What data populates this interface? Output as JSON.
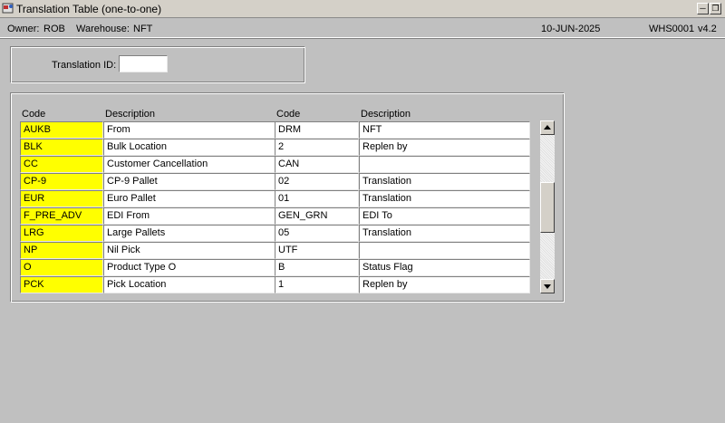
{
  "window": {
    "title": "Translation Table (one-to-one)"
  },
  "infobar": {
    "owner_label": "Owner:",
    "owner_value": "ROB",
    "warehouse_label": "Warehouse:",
    "warehouse_value": "NFT",
    "date": "10-JUN-2025",
    "module": "WHS0001",
    "version": "v4.2"
  },
  "search": {
    "label": "Translation ID:",
    "value": ""
  },
  "table": {
    "headers": [
      "Code",
      "Description",
      "Code",
      "Description"
    ],
    "rows": [
      {
        "code": "AUKB",
        "description": "From",
        "code2": "DRM",
        "description2": "NFT"
      },
      {
        "code": "BLK",
        "description": "Bulk Location",
        "code2": "2",
        "description2": "Replen by"
      },
      {
        "code": "CC",
        "description": "Customer Cancellation",
        "code2": "CAN",
        "description2": ""
      },
      {
        "code": "CP-9",
        "description": "CP-9 Pallet",
        "code2": "02",
        "description2": "Translation"
      },
      {
        "code": "EUR",
        "description": "Euro Pallet",
        "code2": "01",
        "description2": "Translation"
      },
      {
        "code": "F_PRE_ADV",
        "description": "EDI From",
        "code2": "GEN_GRN",
        "description2": "EDI To"
      },
      {
        "code": "LRG",
        "description": "Large Pallets",
        "code2": "05",
        "description2": "Translation"
      },
      {
        "code": "NP",
        "description": "Nil Pick",
        "code2": "UTF",
        "description2": ""
      },
      {
        "code": "O",
        "description": "Product Type O",
        "code2": "B",
        "description2": "Status Flag"
      },
      {
        "code": "PCK",
        "description": "Pick Location",
        "code2": "1",
        "description2": "Replen by"
      }
    ]
  },
  "colors": {
    "code_highlight": "#ffff00",
    "background": "#c0c0c0"
  },
  "icons": {
    "app": "app-icon",
    "minimize": "minimize-icon",
    "restore": "restore-icon",
    "scroll_up": "arrow-up-icon",
    "scroll_down": "arrow-down-icon"
  }
}
